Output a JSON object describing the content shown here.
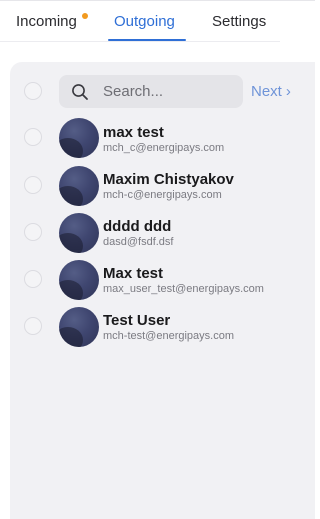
{
  "tabs": [
    {
      "label": "Incoming",
      "has_dot": true,
      "active": false
    },
    {
      "label": "Outgoing",
      "has_dot": false,
      "active": true
    },
    {
      "label": "Settings",
      "has_dot": false,
      "active": false
    }
  ],
  "colors": {
    "accent": "#2f6fd6",
    "notification_dot": "#f29a1f",
    "panel_bg": "#f1f1f4"
  },
  "search": {
    "placeholder": "Search...",
    "value": "",
    "icon": "search-icon"
  },
  "pagination": {
    "next_label": "Next",
    "next_icon": "chevron-right-icon"
  },
  "users": [
    {
      "name": "max test",
      "email": "mch_c@energipays.com"
    },
    {
      "name": "Maxim Chistyakov",
      "email": "mch-c@energipays.com"
    },
    {
      "name": "dddd ddd",
      "email": "dasd@fsdf.dsf"
    },
    {
      "name": "Max test",
      "email": "max_user_test@energipays.com"
    },
    {
      "name": "Test User",
      "email": "mch-test@energipays.com"
    }
  ]
}
